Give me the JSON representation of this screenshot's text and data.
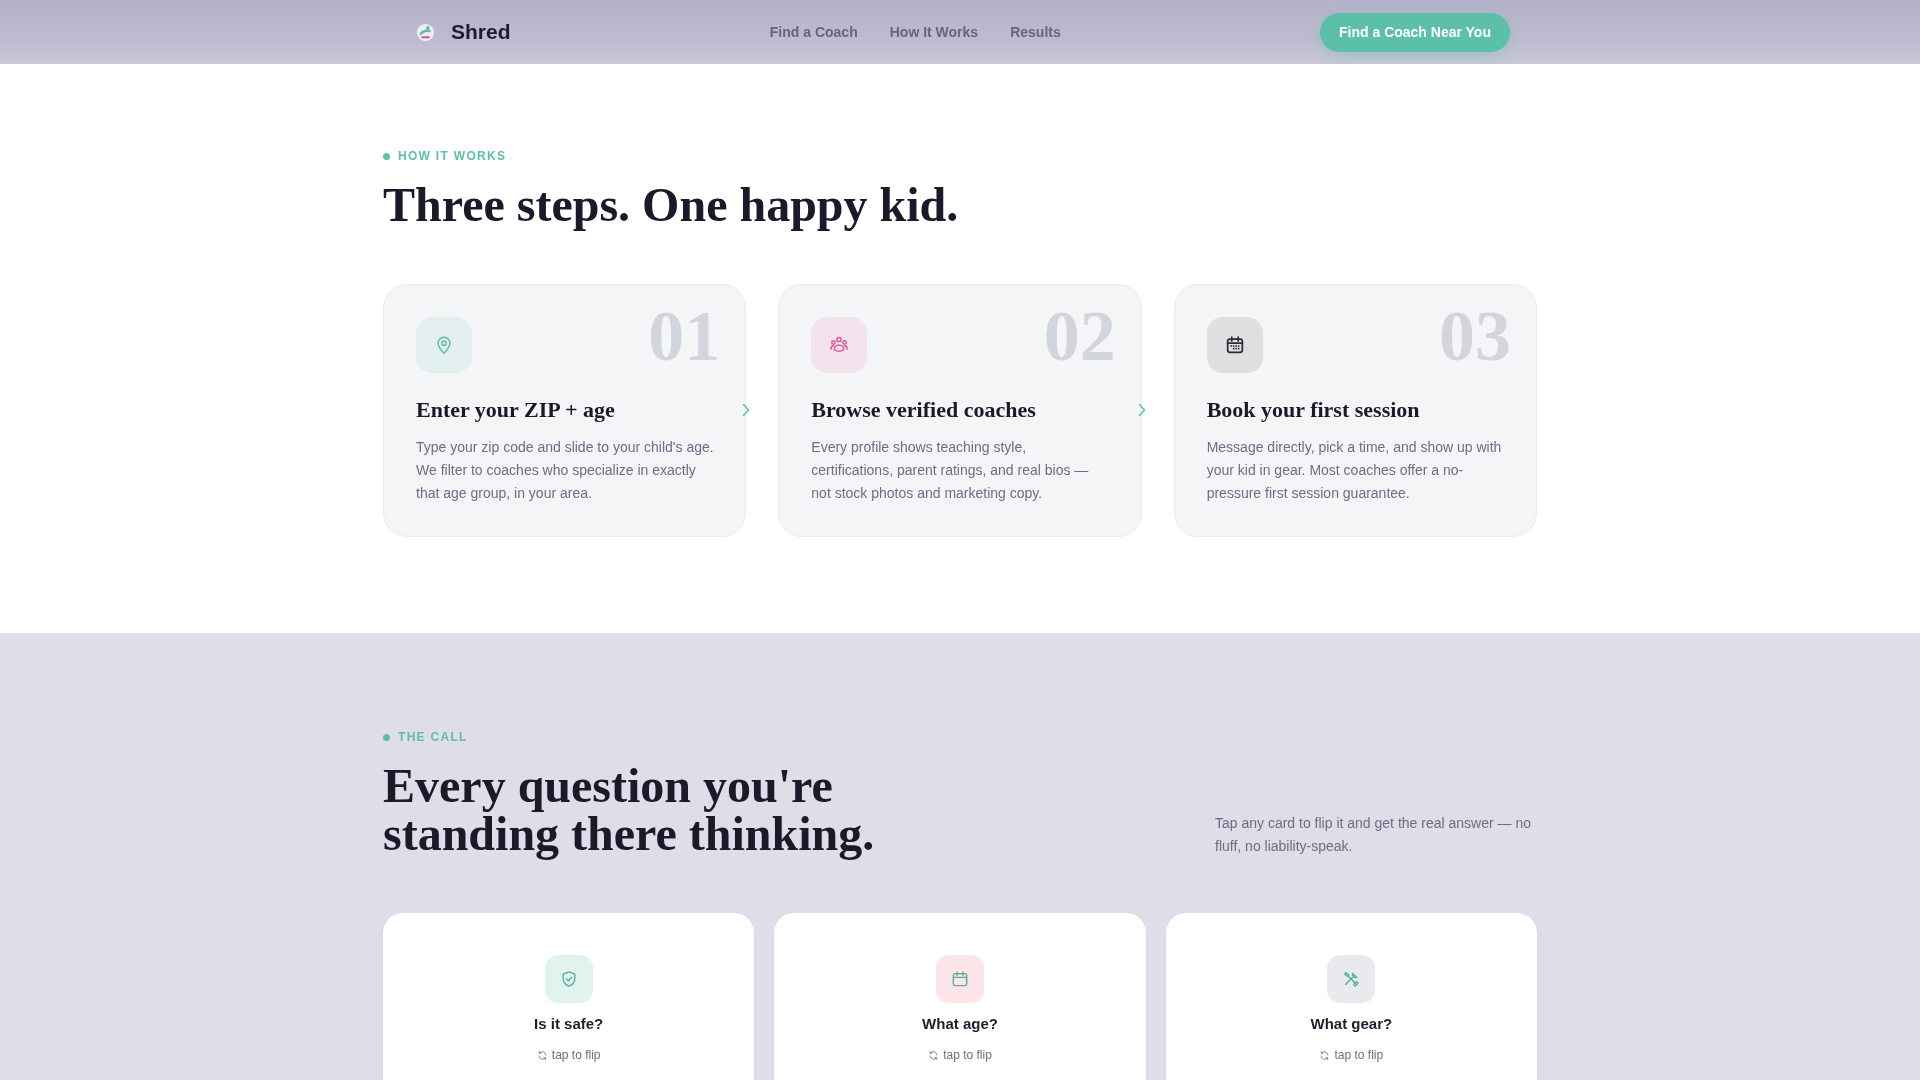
{
  "nav": {
    "brand": "Shred",
    "links": [
      {
        "label": "Find a Coach"
      },
      {
        "label": "How It Works"
      },
      {
        "label": "Results"
      }
    ],
    "cta": "Find a Coach Near You"
  },
  "how_it_works": {
    "eyebrow": "HOW IT WORKS",
    "heading": "Three steps. One happy kid.",
    "steps": [
      {
        "number": "01",
        "title": "Enter your ZIP + age",
        "description": "Type your zip code and slide to your child's age. We filter to coaches who specialize in exactly that age group, in your area.",
        "color": "#5cbfa9"
      },
      {
        "number": "02",
        "title": "Browse verified coaches",
        "description": "Every profile shows teaching style, certifications, parent ratings, and real bios — not stock photos and marketing copy.",
        "color": "#e0559a"
      },
      {
        "number": "03",
        "title": "Book your first session",
        "description": "Message directly, pick a time, and show up with your kid in gear. Most coaches offer a no-pressure first session guarantee.",
        "color": "#2b2b3b"
      }
    ]
  },
  "the_call": {
    "eyebrow": "THE CALL",
    "heading": "Every question you're standing there thinking.",
    "intro": "Tap any card to flip it and get the real answer — no fluff, no liability-speak.",
    "cards": [
      {
        "question": "Is it safe?",
        "hint": "tap to flip",
        "color": "#e2f3ef"
      },
      {
        "question": "What age?",
        "hint": "tap to flip",
        "color": "#fbe5e9"
      },
      {
        "question": "What gear?",
        "hint": "tap to flip",
        "color": "#e9eaee"
      }
    ]
  }
}
